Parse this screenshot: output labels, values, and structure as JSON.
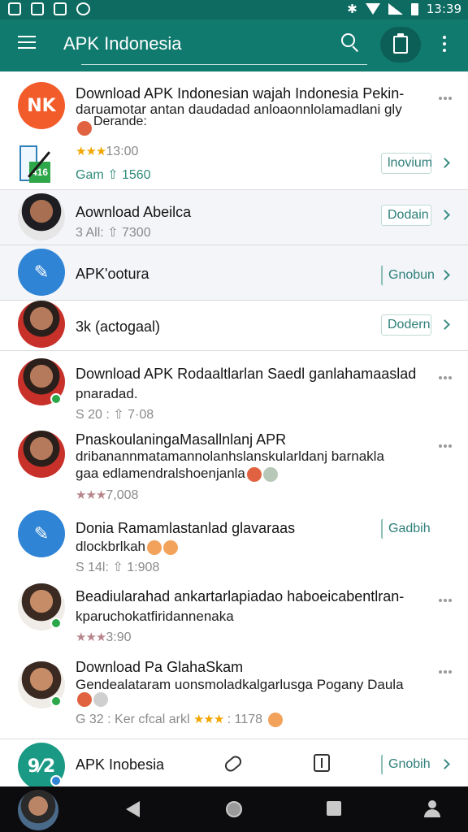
{
  "status_bar": {
    "time": "13:39"
  },
  "app_bar": {
    "title": "APK Indonesia"
  },
  "items": [
    {
      "title": "Download APK Indonesian wajah Indonesia Pekin-",
      "line2": "daruamotar antan daudadad anloaonnlolamadlani gly",
      "line3": "Derande:",
      "rating_text": "13:00",
      "category": "Gam",
      "downloads": "1560",
      "action": "lnovium",
      "avatar_text": "NK"
    },
    {
      "title": "Aownload Abeilca",
      "meta": "3 All:",
      "downloads": "7300",
      "action": "Dodain"
    },
    {
      "title": "APK'ootura",
      "action": "Gnobun"
    },
    {
      "title": "3k (actogaal)",
      "action": "Dodern"
    },
    {
      "title": "Download APK  Rodaaltlarlan Saedl ganlahamaaslad",
      "line2": "pnaradad.",
      "meta": "S 20 :",
      "downloads": "7·08"
    },
    {
      "title": "PnaskoulaningaMasallnlanj APR",
      "line2": "dribanannmatamannolanhslanskularldanj barnakla",
      "line3": "gaa edlamendralshoenjanla",
      "rating_text": "7,008"
    },
    {
      "title": "Donia  Ramamlastanlad glavaraas",
      "line2": "dlockbrlkah",
      "meta": "S 14l:",
      "downloads": "1:908",
      "action": "Gadbih"
    },
    {
      "title": "Beadiularahad ankartarlapiadao haboeicabentlran-",
      "line2": "kparuchokatfiridannenaka",
      "rating_text": "3:90"
    },
    {
      "title": "Download Pa GlahaSkam",
      "line2": "Gendealataram uonsmoladkalgarlusga Pogany Daula",
      "meta": "G 32 : Ker cfcal arkl",
      "rating_text": ": 1178"
    },
    {
      "title": "APK Inobesia",
      "action": "Gnobih",
      "avatar_text": "9⁄2"
    }
  ]
}
